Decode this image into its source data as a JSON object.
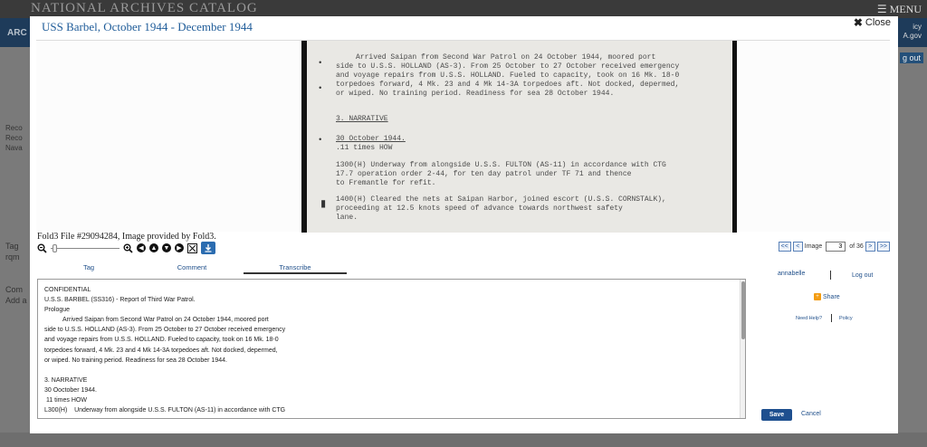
{
  "background": {
    "logo": "NATIONAL ARCHIVES CATALOG",
    "menu": "MENU",
    "arc": "ARC",
    "side_lines": [
      "Reco",
      "Reco",
      "Nava"
    ],
    "side_lower": [
      "Tag",
      "rqm",
      "Com",
      "Add a"
    ],
    "right_lines": [
      "icy",
      "A.gov"
    ],
    "logout": "g out"
  },
  "modal": {
    "title": "USS Barbel, October 1944 - December 1944",
    "close_label": "Close"
  },
  "document_image": {
    "lines": [
      "Arrived Saipan from Second War Patrol on 24 October 1944, moored port",
      "side to U.S.S. HOLLAND (AS-3).  From 25 October to 27 October received emergency",
      "and voyage repairs from U.S.S. HOLLAND.  Fueled to capacity, took on 16 Mk. 18-0",
      "torpedoes forward, 4 Mk. 23 and 4 Mk 14-3A torpedoes aft.  Not docked, depermed,",
      "or wiped.  No training period.  Readiness for sea 28 October 1944.",
      "3.  NARRATIVE",
      "30 October 1944.",
      ".11 times HOW",
      "1300(H)    Underway from alongside U.S.S. FULTON (AS-11) in accordance with CTG",
      "           17.7 operation order 2-44, for ten day patrol under TF 71 and thence",
      "           to Fremantle for refit.",
      "1400(H)    Cleared the nets at Saipan Harbor, joined escort (U.S.S. CORNSTALK),",
      "           proceeding at 12.5 knots speed of advance towards northwest safety",
      "           lane."
    ]
  },
  "credit": "Fold3 File #29094284, Image provided by Fold3.",
  "pager": {
    "first": "<<",
    "prev": "<",
    "label": "Image",
    "current": "3",
    "of_total": "of 36",
    "next": ">",
    "last": ">>"
  },
  "tabs": [
    "Tag",
    "Comment",
    "Transcribe"
  ],
  "transcript_lines": [
    "CONFIDENTIAL",
    "U.S.S. BARBEL (SS316) - Report of Third War Patrol.",
    "Prologue",
    "Arrived Saipan from Second War Patrol on 24 October 1944, moored port",
    "side to U.S.S. HOLLAND (AS-3). From 25 October to 27 October received emergency",
    "and voyage repairs from U.S.S. HOLLAND. Fueled to capacity, took on 16 Mk. 18-0",
    "torpedoes forward, 4 Mk. 23 and 4 Mk 14-3A torpedoes aft. Not docked, depermed,",
    "or wiped. No training period. Readiness for sea 28 October 1944.",
    "",
    "3. NARRATIVE",
    "30 Ooctober 1944.",
    " 11 times HOW",
    "L300(H)    Underway from alongside U.S.S. FULTON (AS-11) in accordance with CTG"
  ],
  "user": {
    "name": "annabelle",
    "logout": "Log out",
    "share": "Share",
    "need_help": "Need Help?",
    "policy": "Policy"
  },
  "actions": {
    "save": "Save",
    "cancel": "Cancel"
  },
  "colors": {
    "accent": "#1f5c99",
    "save_button": "#1e4f8f",
    "download_button": "#2b6cb0",
    "share_icon": "#f39c12"
  }
}
